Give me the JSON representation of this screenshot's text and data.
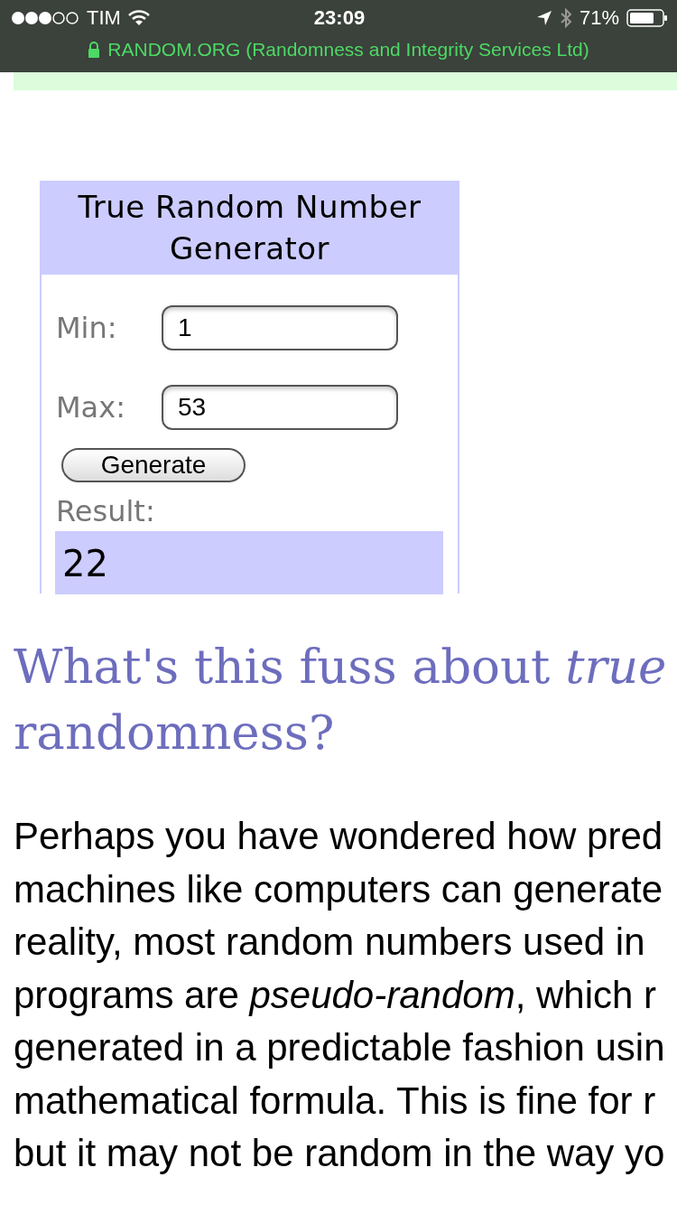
{
  "status_bar": {
    "carrier": "TIM",
    "time": "23:09",
    "battery": "71%",
    "site": "RANDOM.ORG (Randomness and Integrity Services Ltd)"
  },
  "widget": {
    "title": "True Random Number Generator",
    "fields": [
      {
        "label": "Min:",
        "value": "1"
      },
      {
        "label": "Max:",
        "value": "53"
      }
    ],
    "button": "Generate",
    "result_label": "Result:",
    "result": "22"
  },
  "heading": [
    "What's this fuss about *true*",
    "randomness?"
  ],
  "paragraph": [
    "Perhaps you have wondered how pred",
    "machines like computers can generate",
    "reality, most random numbers used in",
    "programs are *pseudo-random*, which r",
    "generated in a predictable fashion usin",
    "mathematical formula. This is fine for r",
    "but it may not be random in the way yo"
  ]
}
